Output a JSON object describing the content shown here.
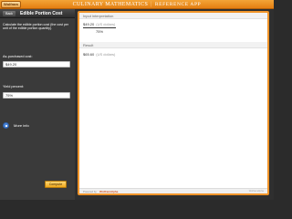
{
  "app": {
    "badge": "Wolfram",
    "title": "CULINARY MATHEMATICS",
    "separator": "|",
    "subtitle": "REFERENCE APP"
  },
  "left_panel": {
    "back_label": "Back",
    "title": "Edible Portion Cost",
    "description": "Calculate the edible portion cost (the cost per unit of the edible portion quantity).",
    "fields": [
      {
        "label": "As-purchased cost:",
        "value": "$49.20"
      },
      {
        "label": "Yield percent:",
        "value": "75%"
      }
    ],
    "more_info_label": "More info",
    "compute_label": "Compute"
  },
  "results": {
    "input_interpretation": {
      "title": "Input interpretation",
      "numerator": "$49.20",
      "numerator_unit": "(US dollars)",
      "denominator": "75%"
    },
    "result": {
      "title": "Result",
      "value": "$65.60",
      "unit": "(US dollars)"
    },
    "footer": {
      "powered_by": "Powered by",
      "brand": "WolframAlpha",
      "right_tag": "WolframAlpha"
    }
  },
  "colors": {
    "accent": "#f1952a",
    "topbar": "#e47f12",
    "panel": "#3a3a3a",
    "more_info": "#4a84d8",
    "compute": "#f0a81a"
  }
}
